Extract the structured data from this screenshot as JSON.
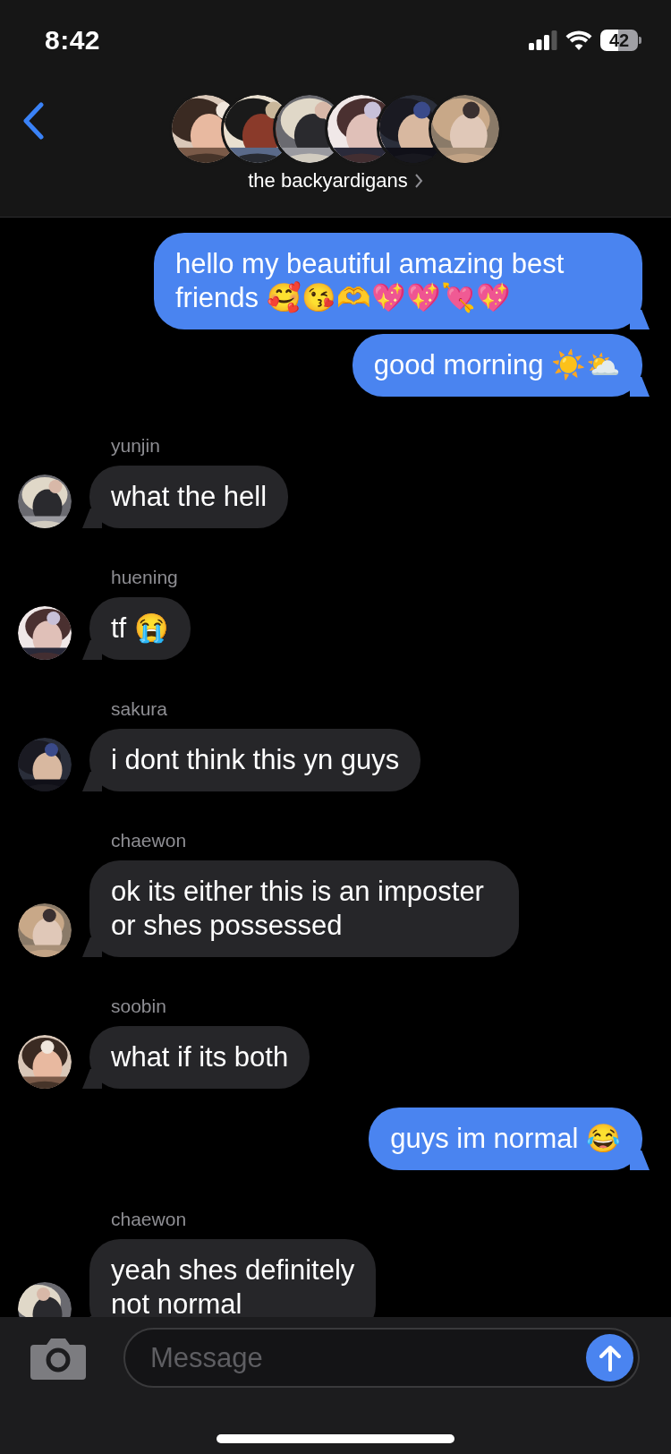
{
  "status_bar": {
    "time": "8:42",
    "battery": "42"
  },
  "header": {
    "title": "the backyardigans"
  },
  "messages": [
    {
      "kind": "outgoing",
      "text": "hello my beautiful amazing best friends 🥰😘🫶💖💖💘💖"
    },
    {
      "kind": "outgoing",
      "text": "good morning ☀️⛅️"
    },
    {
      "kind": "incoming",
      "sender": "yunjin",
      "text": "what the hell"
    },
    {
      "kind": "incoming",
      "sender": "huening",
      "text": "tf 😭"
    },
    {
      "kind": "incoming",
      "sender": "sakura",
      "text": "i dont think this yn guys"
    },
    {
      "kind": "incoming",
      "sender": "chaewon",
      "text": "ok its either this is an imposter or shes possessed"
    },
    {
      "kind": "incoming",
      "sender": "soobin",
      "text": "what if its both"
    },
    {
      "kind": "outgoing",
      "text": "guys im normal 😂"
    },
    {
      "kind": "incoming",
      "sender": "chaewon",
      "text": "yeah shes definitely\nnot normal"
    }
  ],
  "composer": {
    "placeholder": "Message"
  }
}
